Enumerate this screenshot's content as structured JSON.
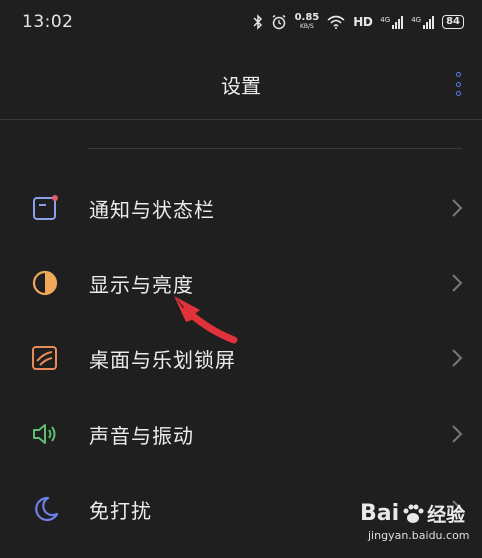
{
  "status": {
    "time": "13:02",
    "net_speed_value": "0.85",
    "net_speed_unit": "KB/S",
    "hd_label": "HD",
    "signal1_label": "4G",
    "signal2_label": "4G",
    "battery": "84"
  },
  "header": {
    "title": "设置"
  },
  "menu": [
    {
      "label": "通知与状态栏",
      "icon": "notification-icon"
    },
    {
      "label": "显示与亮度",
      "icon": "display-brightness-icon"
    },
    {
      "label": "桌面与乐划锁屏",
      "icon": "wallpaper-icon"
    },
    {
      "label": "声音与振动",
      "icon": "speaker-icon"
    },
    {
      "label": "免打扰",
      "icon": "moon-icon"
    }
  ],
  "watermark": {
    "brand_a": "Bai",
    "brand_b": "经验",
    "url": "jingyan.baidu.com"
  },
  "colors": {
    "accent": "#5b7de8",
    "annotation": "#e0323a",
    "background": "#1f1f1f"
  }
}
